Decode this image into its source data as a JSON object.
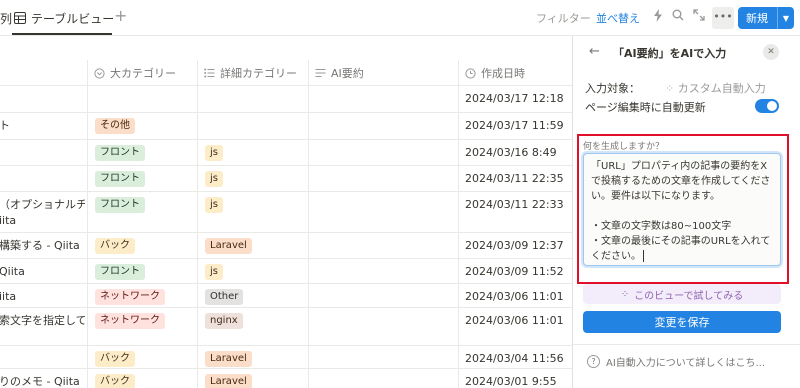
{
  "topbar": {
    "prev_tab_label": "列",
    "active_tab_label": "テーブルビュー",
    "filter_label": "フィルター",
    "sort_label": "並べ替え",
    "new_label": "新規",
    "icons": [
      "table-icon",
      "plus-icon",
      "lightning-icon",
      "search-icon",
      "expand-icon",
      "more-icon",
      "chevron-down-icon"
    ]
  },
  "table": {
    "columns": [
      {
        "label": "",
        "icon": ""
      },
      {
        "label": "大カテゴリー",
        "icon": "select-icon"
      },
      {
        "label": "詳細カテゴリー",
        "icon": "list-icon"
      },
      {
        "label": "AI要約",
        "icon": "text-icon"
      },
      {
        "label": "作成日時",
        "icon": "clock-icon"
      }
    ],
    "rows": [
      {
        "title": "",
        "category": "",
        "category_color": "",
        "detail": "",
        "detail_color": "",
        "created": "2024/03/17 12:18"
      },
      {
        "title": "ト",
        "category": "その他",
        "category_color": "orange",
        "detail": "",
        "detail_color": "",
        "created": "2024/03/17 11:59"
      },
      {
        "title": "",
        "category": "フロント",
        "category_color": "green",
        "detail": "js",
        "detail_color": "yellow",
        "created": "2024/03/16 8:49"
      },
      {
        "title": "",
        "category": "フロント",
        "category_color": "green",
        "detail": "js",
        "detail_color": "yellow",
        "created": "2024/03/11 22:35"
      },
      {
        "title": "（オプショナルチ\niita",
        "category": "フロント",
        "category_color": "green",
        "detail": "js",
        "detail_color": "yellow",
        "created": "2024/03/11 22:33"
      },
      {
        "title": "構築する - Qiita",
        "category": "バック",
        "category_color": "yellow",
        "detail": "Laravel",
        "detail_color": "orange",
        "created": "2024/03/09 12:37"
      },
      {
        "title": "Qiita",
        "category": "フロント",
        "category_color": "green",
        "detail": "js",
        "detail_color": "yellow",
        "created": "2024/03/09 11:52"
      },
      {
        "title": "iita",
        "category": "ネットワーク",
        "category_color": "red",
        "detail": "Other",
        "detail_color": "gray",
        "created": "2024/03/06 11:01"
      },
      {
        "title": "索文字を指定して",
        "category": "ネットワーク",
        "category_color": "red",
        "detail": "nginx",
        "detail_color": "brown",
        "created": "2024/03/06 11:01"
      },
      {
        "title": "",
        "category": "バック",
        "category_color": "yellow",
        "detail": "Laravel",
        "detail_color": "orange",
        "created": "2024/03/04 11:56"
      },
      {
        "title": "りのメモ - Qiita",
        "category": "バック",
        "category_color": "yellow",
        "detail": "Laravel",
        "detail_color": "orange",
        "created": "2024/03/01 9:55"
      }
    ]
  },
  "panel": {
    "title": "「AI要約」をAIで入力",
    "input_target_label": "入力対象：",
    "input_target_value": "カスタム自動入力",
    "auto_update_label": "ページ編集時に自動更新",
    "auto_update_on": true,
    "question": "何を生成しますか？",
    "prompt_text": "「URL」プロパティ内の記事の要約をX\nで投稿するための文章を作成してくださ\nい。要件は以下になります。\n\n・文章の文字数は80~100文字\n・文章の最後にその記事のURLを入れて\nください。",
    "try_label": "このビューで試してみる",
    "save_label": "変更を保存",
    "help_label": "AI自動入力について詳しくはこち...",
    "icons": [
      "arrow-left-icon",
      "close-icon",
      "sparkle-icon",
      "question-icon"
    ]
  },
  "colors": {
    "accent": "#2383e2",
    "highlight_border": "#e0102a",
    "try_button_bg": "#f3ecfa",
    "try_button_text": "#9065b0"
  }
}
